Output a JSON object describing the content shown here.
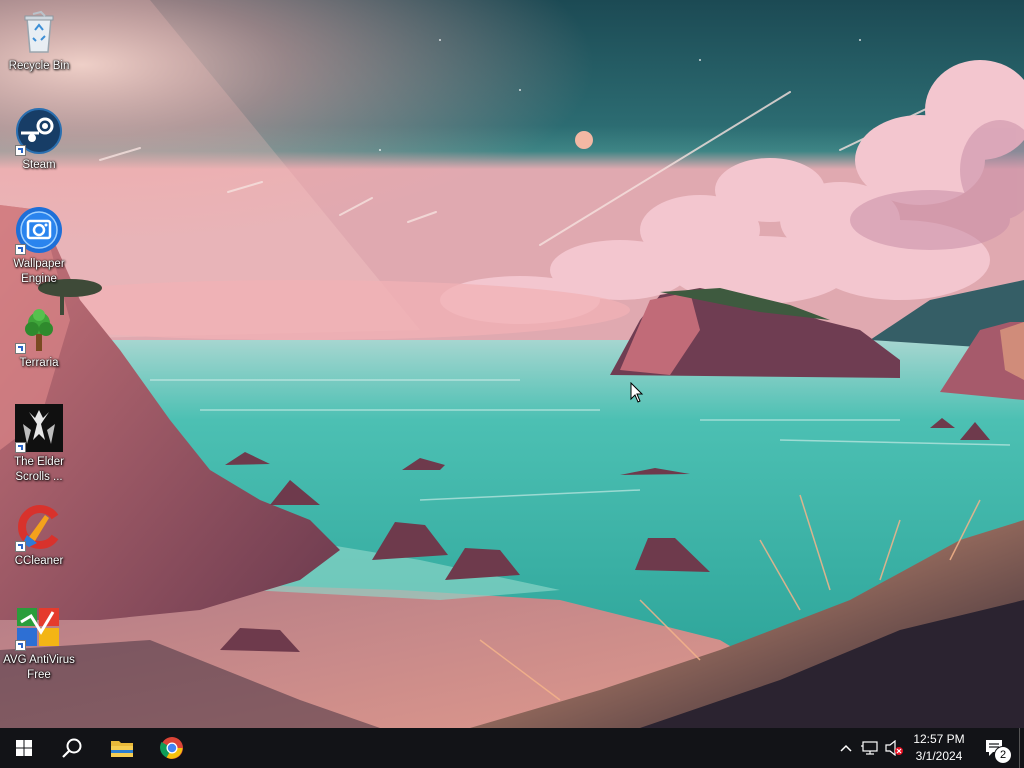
{
  "desktop": {
    "icons": [
      {
        "label": "Recycle Bin",
        "icon": "recycle-bin-icon",
        "shortcut": false
      },
      {
        "label": "Steam",
        "icon": "steam-icon",
        "shortcut": true
      },
      {
        "label": "Wallpaper Engine",
        "icon": "wallpaper-engine-icon",
        "shortcut": true
      },
      {
        "label": "Terraria",
        "icon": "terraria-icon",
        "shortcut": true
      },
      {
        "label": "The Elder Scrolls ...",
        "icon": "elder-scrolls-icon",
        "shortcut": true
      },
      {
        "label": "CCleaner",
        "icon": "ccleaner-icon",
        "shortcut": true
      },
      {
        "label": "AVG AntiVirus Free",
        "icon": "avg-antivirus-icon",
        "shortcut": true
      }
    ]
  },
  "taskbar": {
    "start": "windows-start-icon",
    "search": "search-icon",
    "pinned": [
      "file-explorer-icon",
      "chrome-icon"
    ],
    "tray": {
      "overflow": "chevron-up-icon",
      "network": "network-icon",
      "volume": "volume-muted-icon",
      "time": "12:57 PM",
      "date": "3/1/2024",
      "notifications_count": "2",
      "notifications": "action-center-icon"
    }
  },
  "colors": {
    "taskbar": "#121317",
    "sky_top": "#1f4f57",
    "sea": "#3fb5a8",
    "sand": "#d98a84"
  }
}
